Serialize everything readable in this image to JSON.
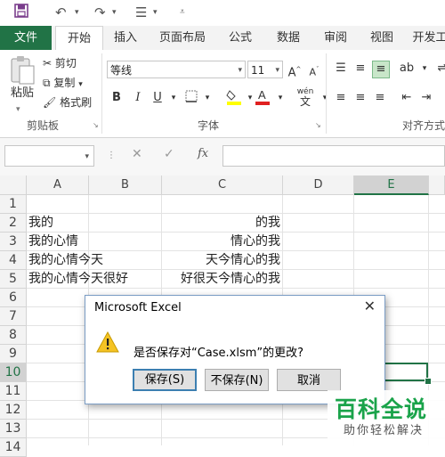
{
  "qat": {
    "save_icon": "save-icon",
    "undo_icon": "undo-icon",
    "redo_icon": "redo-icon"
  },
  "tabs": [
    {
      "label": "文件"
    },
    {
      "label": "开始"
    },
    {
      "label": "插入"
    },
    {
      "label": "页面布局"
    },
    {
      "label": "公式"
    },
    {
      "label": "数据"
    },
    {
      "label": "审阅"
    },
    {
      "label": "视图"
    },
    {
      "label": "开发工"
    }
  ],
  "ribbon": {
    "paste_label": "粘贴",
    "cut_label": "剪切",
    "copy_label": "复制",
    "format_painter_label": "格式刷",
    "clipboard_group": "剪贴板",
    "font_name": "等线",
    "font_size": "11",
    "font_group": "字体",
    "align_group": "对齐方式",
    "bold": "B",
    "italic": "I",
    "underline": "U",
    "wen_top": "wén",
    "wen_bottom": "文"
  },
  "formula_bar": {
    "fx": "fx"
  },
  "sheet": {
    "columns": [
      "A",
      "B",
      "C",
      "D",
      "E"
    ],
    "rows": [
      "1",
      "2",
      "3",
      "4",
      "5",
      "6",
      "7",
      "8",
      "9",
      "10",
      "11",
      "12",
      "13",
      "14"
    ],
    "cells": {
      "a2": "我的",
      "c2": "的我",
      "a3": "我的心情",
      "c3": "情心的我",
      "a4": "我的心情今天",
      "c4": "天今情心的我",
      "a5": "我的心情今天很好",
      "c5": "好很天今情心的我"
    }
  },
  "dialog": {
    "title": "Microsoft Excel",
    "message": "是否保存对“Case.xlsm”的更改?",
    "save": "保存(S)",
    "dont_save": "不保存(N)",
    "cancel": "取消"
  },
  "watermark": {
    "title": "百科全说",
    "subtitle": "助你轻松解决"
  }
}
